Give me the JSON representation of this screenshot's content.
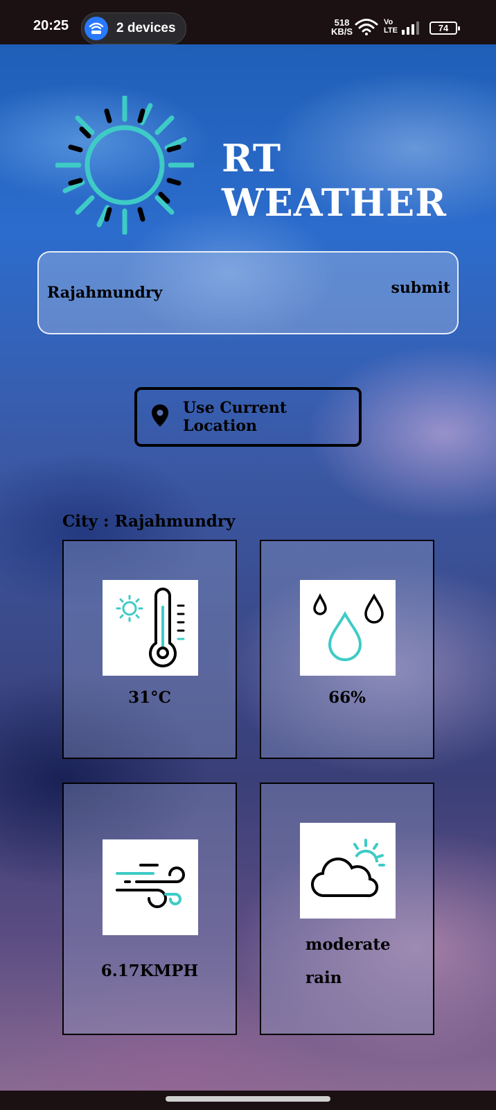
{
  "status_bar": {
    "time": "20:25",
    "devices_label": "2 devices",
    "net_speed_value": "518",
    "net_speed_unit": "KB/S",
    "volte_top": "Vo",
    "volte_bottom": "LTE",
    "battery": "74"
  },
  "header": {
    "title": "RT WEATHER",
    "logo_icon": "sun-icon"
  },
  "search": {
    "value": "Rajahmundry",
    "placeholder": "",
    "submit_label": "submit"
  },
  "location_button": {
    "label": "Use Current Location",
    "icon": "map-pin-icon"
  },
  "city_label": "City : Rajahmundry",
  "cards": {
    "temperature": {
      "value": "31°C",
      "icon": "thermometer-icon"
    },
    "humidity": {
      "value": "66%",
      "icon": "water-drops-icon"
    },
    "wind": {
      "value": "6.17KMPH",
      "icon": "wind-icon"
    },
    "condition": {
      "line1": "moderate",
      "line2": "rain",
      "icon": "cloud-sun-icon"
    }
  },
  "colors": {
    "accent": "#3ecbc6",
    "title": "#ffffff",
    "status_bar": "#1b1012",
    "pill_icon": "#2979ff"
  }
}
